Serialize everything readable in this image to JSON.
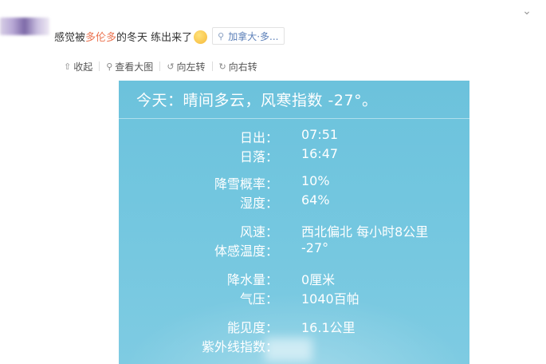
{
  "post": {
    "text_prefix": "感觉被",
    "text_tag": "多伦多",
    "text_suffix": "的冬天 练出来了",
    "location": "加拿大·多..."
  },
  "toolbar": {
    "collapse": "收起",
    "view_large": "查看大图",
    "rotate_left": "向左转",
    "rotate_right": "向右转"
  },
  "weather": {
    "header": "今天：晴间多云，风寒指数 -27°。",
    "rows": [
      {
        "label": "日出：",
        "value": "07:51"
      },
      {
        "label": "日落：",
        "value": "16:47"
      },
      {
        "label": "降雪概率：",
        "value": "10%"
      },
      {
        "label": "湿度：",
        "value": "64%"
      },
      {
        "label": "风速：",
        "value": "西北偏北 每小时8公里"
      },
      {
        "label": "体感温度：",
        "value": "-27°"
      },
      {
        "label": "降水量：",
        "value": "0厘米"
      },
      {
        "label": "气压：",
        "value": "1040百帕"
      },
      {
        "label": "能见度：",
        "value": "16.1公里"
      },
      {
        "label": "紫外线指数：",
        "value": ""
      }
    ]
  },
  "colors": {
    "tag": "#eb7350",
    "card_bg": "#72c6df",
    "link": "#5b7fb8"
  }
}
